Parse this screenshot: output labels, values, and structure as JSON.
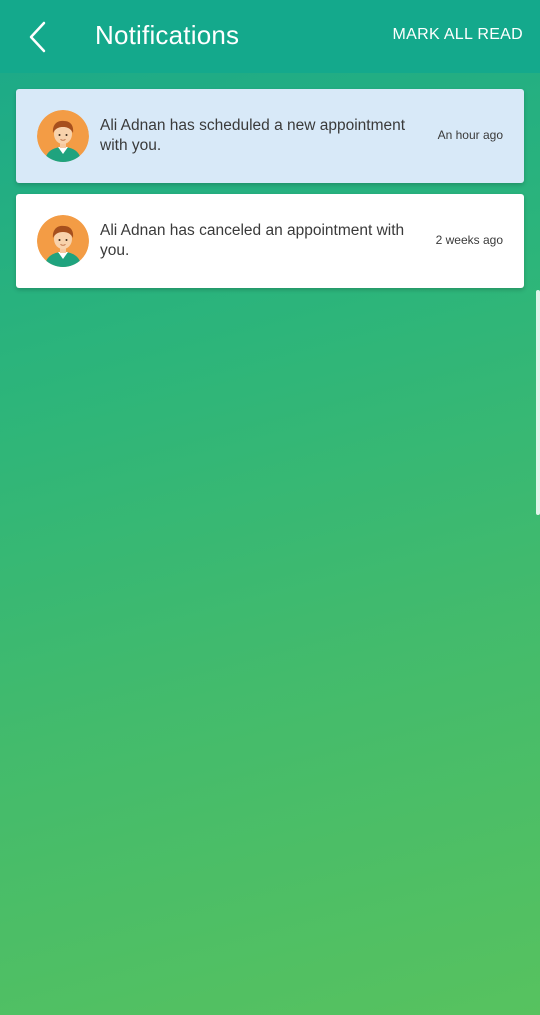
{
  "header": {
    "title": "Notifications",
    "mark_all_read_label": "MARK ALL READ",
    "back_icon": "chevron-left-icon"
  },
  "notifications": [
    {
      "message": "Ali Adnan has scheduled a new appointment with you.",
      "time": "An hour ago",
      "unread": true,
      "avatar_icon": "user-avatar-icon"
    },
    {
      "message": "Ali Adnan has canceled an appointment with you.",
      "time": "2 weeks ago",
      "unread": false,
      "avatar_icon": "user-avatar-icon"
    }
  ],
  "colors": {
    "header_bg": "#14a98c",
    "unread_card_bg": "#d8e9f8",
    "read_card_bg": "#ffffff",
    "gradient_start": "#1aa88a",
    "gradient_end": "#57c25f",
    "avatar_bg": "#f39c45"
  }
}
